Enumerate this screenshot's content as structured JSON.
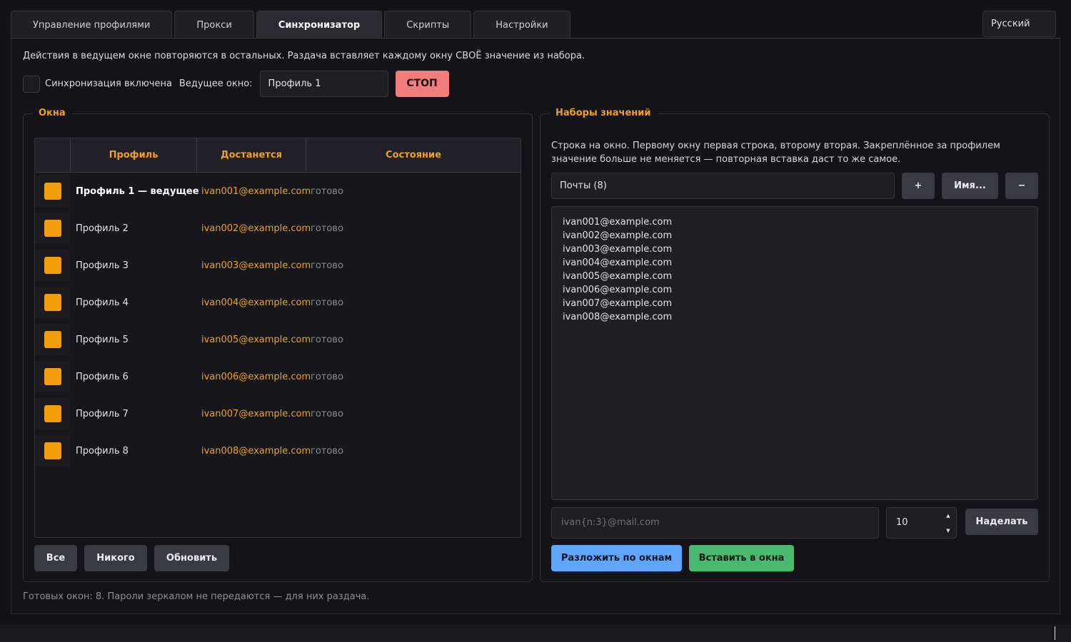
{
  "tabs": [
    {
      "label": "Управление профилями",
      "active": false
    },
    {
      "label": "Прокси",
      "active": false
    },
    {
      "label": "Синхронизатор",
      "active": true
    },
    {
      "label": "Скрипты",
      "active": false
    },
    {
      "label": "Настройки",
      "active": false
    }
  ],
  "language": "Русский",
  "description": "Действия в ведущем окне повторяются в остальных. Раздача вставляет каждому окну СВОЁ значение из набора.",
  "sync": {
    "checkbox_label": "Синхронизация включена",
    "lead_label": "Ведущее окно:",
    "lead_value": "Профиль 1",
    "stop_label": "СТОП"
  },
  "windows": {
    "title": "Окна",
    "columns": [
      "Профиль",
      "Достанется",
      "Состояние"
    ],
    "rows": [
      {
        "name": "Профиль 1  — ведущее",
        "email": "ivan001@example.com",
        "state": "готово"
      },
      {
        "name": "Профиль 2",
        "email": "ivan002@example.com",
        "state": "готово"
      },
      {
        "name": "Профиль 3",
        "email": "ivan003@example.com",
        "state": "готово"
      },
      {
        "name": "Профиль 4",
        "email": "ivan004@example.com",
        "state": "готово"
      },
      {
        "name": "Профиль 5",
        "email": "ivan005@example.com",
        "state": "готово"
      },
      {
        "name": "Профиль 6",
        "email": "ivan006@example.com",
        "state": "готово"
      },
      {
        "name": "Профиль 7",
        "email": "ivan007@example.com",
        "state": "готово"
      },
      {
        "name": "Профиль 8",
        "email": "ivan008@example.com",
        "state": "готово"
      }
    ],
    "buttons": {
      "all": "Все",
      "none": "Никого",
      "refresh": "Обновить"
    }
  },
  "sets": {
    "title": "Наборы значений",
    "description": "Строка на окно. Первому окну первая строка, второму вторая. Закреплённое за профилем значение больше не меняется — повторная вставка даст то же самое.",
    "selected_set": "Почты (8)",
    "add_label": "+",
    "rename_label": "Имя...",
    "remove_label": "−",
    "lines": [
      "ivan001@example.com",
      "ivan002@example.com",
      "ivan003@example.com",
      "ivan004@example.com",
      "ivan005@example.com",
      "ivan006@example.com",
      "ivan007@example.com",
      "ivan008@example.com"
    ],
    "template_placeholder": "ivan{n:3}@mail.com",
    "count_value": "10",
    "make_label": "Наделать",
    "distribute_label": "Разложить по окнам",
    "paste_label": "Вставить в окна"
  },
  "status": "Готовых окон: 8. Пароли зеркалом не передаются — для них раздача.",
  "colors": {
    "accent": "#f0a020",
    "stop": "#f27c7c",
    "blue": "#60a5fa",
    "green": "#4ab86f"
  }
}
